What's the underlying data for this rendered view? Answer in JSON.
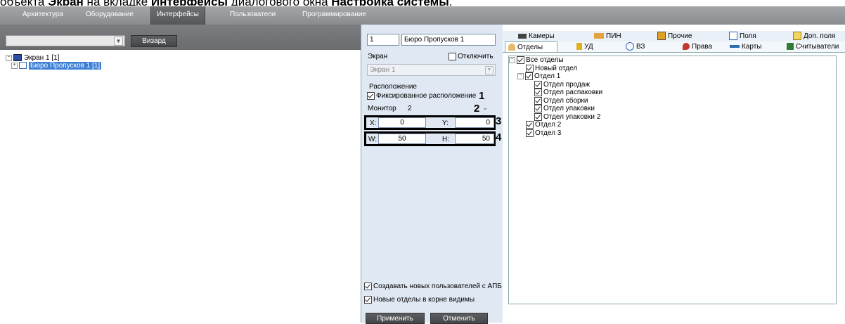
{
  "caption": {
    "prefix": "объекта ",
    "bold1": "Экран",
    "mid": " на вкладке ",
    "bold2": "Интерфейсы",
    "mid2": " диалогового окна ",
    "bold3": "Настройка системы",
    "end": "."
  },
  "tabs": [
    "Архитектура",
    "Оборудование",
    "Интерфейсы",
    "Пользователи",
    "Программирование"
  ],
  "left": {
    "wizard_label": "Визард",
    "combo_value": "",
    "tree": [
      {
        "label": "Экран 1 [1]"
      },
      {
        "label": "Бюро Пропусков 1 [1]"
      }
    ]
  },
  "props": {
    "id_value": "1",
    "name_value": "Бюро Пропусков 1",
    "screen_label": "Экран",
    "disable_label": "Отключить",
    "screen_value": "Экран 1",
    "location_label": "Расположение",
    "fixed_label": "Фиксированное расположение",
    "monitor_label": "Монитор",
    "monitor_value": "2",
    "x_label": "X:",
    "x_value": "0",
    "y_label": "Y:",
    "y_value": "0",
    "w_label": "W:",
    "w_value": "50",
    "h_label": "H:",
    "h_value": "50",
    "create_users_label": "Создавать новых пользователей с АПБ",
    "new_depts_label": "Новые отделы в корне видимы",
    "apply_label": "Применить",
    "cancel_label": "Отменить",
    "callouts": [
      "1",
      "2",
      "3",
      "4"
    ]
  },
  "right_tabs_row1": [
    "Камеры",
    "ПИН",
    "Прочие",
    "Поля",
    "Доп. поля"
  ],
  "right_tabs_row2": [
    "Отделы",
    "УД",
    "ВЗ",
    "Права",
    "Карты",
    "Считыватели"
  ],
  "departments": [
    {
      "label": "Все отделы",
      "level": 0,
      "expander": "-"
    },
    {
      "label": "Новый отдел",
      "level": 1,
      "expander": ""
    },
    {
      "label": "Отдел 1",
      "level": 1,
      "expander": "-"
    },
    {
      "label": "Отдел продаж",
      "level": 2,
      "expander": ""
    },
    {
      "label": "Отдел распаковки",
      "level": 2,
      "expander": ""
    },
    {
      "label": "Отдел сборки",
      "level": 2,
      "expander": ""
    },
    {
      "label": "Отдел упаковки",
      "level": 2,
      "expander": ""
    },
    {
      "label": "Отдел упаковки 2",
      "level": 2,
      "expander": ""
    },
    {
      "label": "Отдел 2",
      "level": 1,
      "expander": ""
    },
    {
      "label": "Отдел 3",
      "level": 1,
      "expander": ""
    }
  ],
  "colors": {
    "accent": "#3d7fd6",
    "panel": "#dfe8f3",
    "topbar": "#8a8c8f"
  }
}
